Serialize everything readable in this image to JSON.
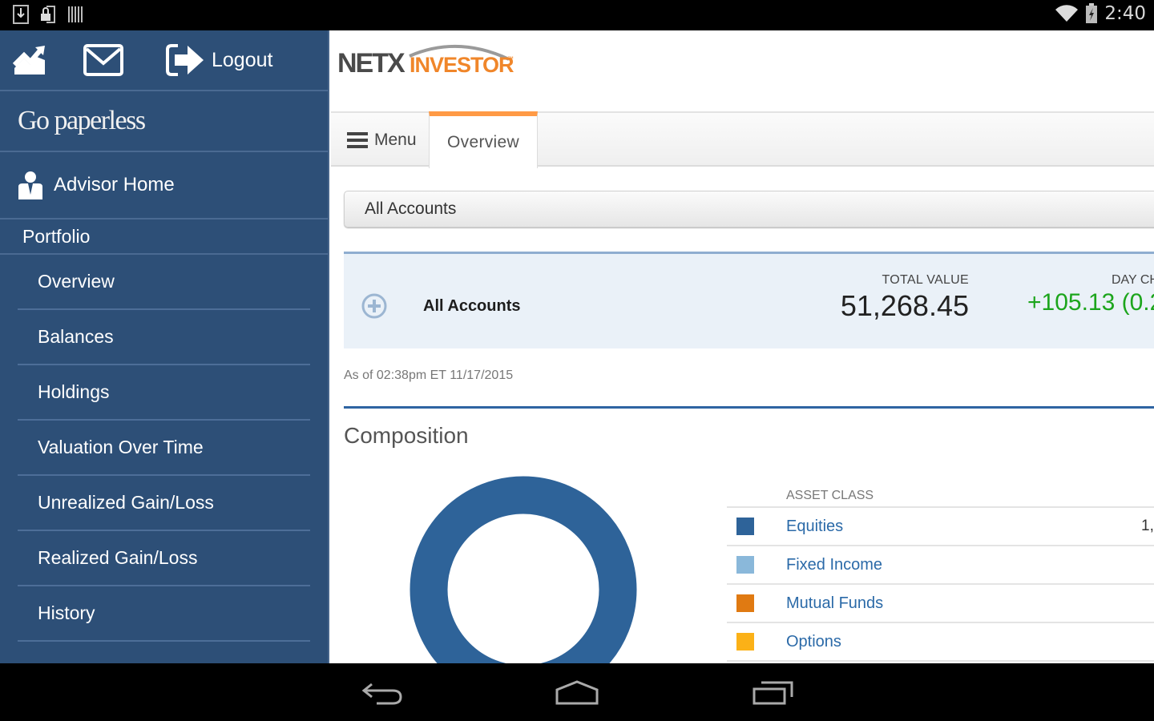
{
  "status_bar": {
    "left_icons": [
      "download-icon",
      "lock-screen-icon",
      "barcode-icon"
    ],
    "right_icons": [
      "wifi-icon",
      "battery-charging-icon"
    ],
    "time": "2:40"
  },
  "sidebar": {
    "top_icons": [
      "chart-trend-icon",
      "mail-icon",
      "logout-icon"
    ],
    "logout_label": "Logout",
    "paperless_label": "Go paperless",
    "advisor_home_label": "Advisor Home",
    "section_label": "Portfolio",
    "items": [
      {
        "label": "Overview"
      },
      {
        "label": "Balances"
      },
      {
        "label": "Holdings"
      },
      {
        "label": "Valuation Over Time"
      },
      {
        "label": "Unrealized Gain/Loss"
      },
      {
        "label": "Realized Gain/Loss"
      },
      {
        "label": "History"
      }
    ]
  },
  "header": {
    "logo_text_1": "NETX",
    "logo_text_2": "INVESTOR",
    "logo_tm": "™"
  },
  "tabs": {
    "menu_label": "Menu",
    "active_tab": "Overview"
  },
  "account_select": {
    "selected": "All Accounts"
  },
  "summary": {
    "account_name": "All Accounts",
    "total_value_label": "TOTAL VALUE",
    "total_value": "51,268.45",
    "day_change_label": "DAY CH",
    "day_change_value": "+105.13 (0.2"
  },
  "as_of": "As of 02:38pm ET 11/17/2015",
  "composition": {
    "title": "Composition",
    "legend_header": "ASSET CLASS",
    "rows": [
      {
        "label": "Equities",
        "color": "#2e6399",
        "value": "1,"
      },
      {
        "label": "Fixed Income",
        "color": "#8ab8da",
        "value": ""
      },
      {
        "label": "Mutual Funds",
        "color": "#e07a12",
        "value": ""
      },
      {
        "label": "Options",
        "color": "#fbb117",
        "value": ""
      }
    ],
    "donut_color": "#2e6399"
  },
  "colors": {
    "sidebar_bg": "#2d4f77",
    "accent_orange": "#ff9a45",
    "link_blue": "#2b6aa8",
    "positive_green": "#1ca51c"
  }
}
